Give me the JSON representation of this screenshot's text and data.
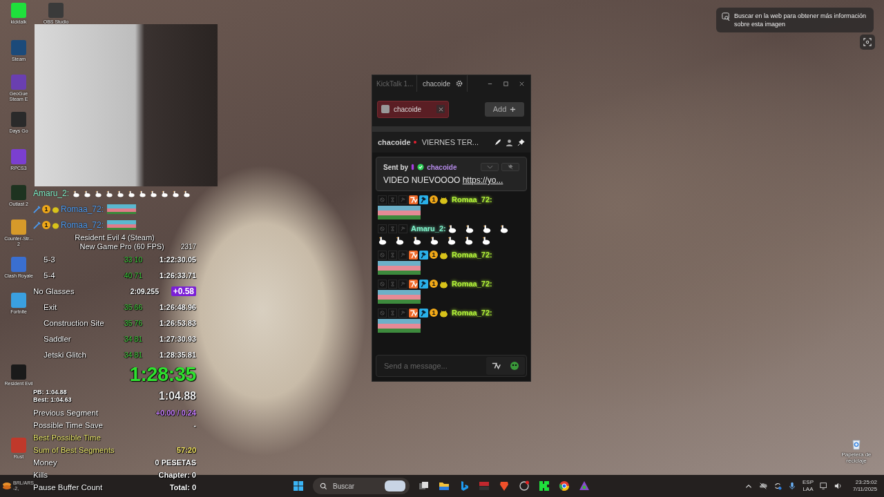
{
  "desktop_icons": [
    {
      "label": "kicktalk",
      "color": "#1fe03c"
    },
    {
      "label": "OBS Studio",
      "color": "#3a3a3a"
    },
    {
      "label": "Steam",
      "color": "#1b4a7a"
    },
    {
      "label": "GeoGue Steam E",
      "color": "#6a3fb0"
    },
    {
      "label": "Days Go",
      "color": "#2a2a2a"
    },
    {
      "label": "RPCS3",
      "color": "#7b3fd0"
    },
    {
      "label": "Outlast 2",
      "color": "#1e3320"
    },
    {
      "label": "Counter-Str... 2",
      "color": "#d79a2a"
    },
    {
      "label": "Clash Royale",
      "color": "#3a6fd0"
    },
    {
      "label": "Fortnite",
      "color": "#3aa0e0"
    },
    {
      "label": "Resident Evil",
      "color": "#1a1a1a"
    },
    {
      "label": "Rust",
      "color": "#c0392b"
    }
  ],
  "recycle_bin": {
    "label": "Papelera de reciclaje"
  },
  "lens_tooltip": {
    "text": "Buscar en la web para obtener más información sobre esta imagen"
  },
  "overlay_chat": [
    {
      "user": "Amaru_2:",
      "color": "#7ef0c8",
      "badged": false,
      "kind": "geese"
    },
    {
      "user": "Romaa_72:",
      "color": "#4a9af0",
      "badged": true,
      "kind": "image",
      "badge_text": "1"
    },
    {
      "user": "Romaa_72:",
      "color": "#4a9af0",
      "badged": true,
      "kind": "image",
      "badge_text": "1"
    }
  ],
  "timer": {
    "game": "Resident Evil 4 (Steam)",
    "category": "New Game Pro (60 FPS)",
    "attempts": "2317",
    "splits": [
      {
        "kind": "split",
        "name": "5-3",
        "delta": "33 10",
        "time": "1:22:30.05",
        "color": "#3bd13b"
      },
      {
        "kind": "split",
        "name": "5-4",
        "delta": "40 71",
        "time": "1:26:33.71",
        "color": "#3bd13b"
      },
      {
        "kind": "header",
        "name": "No Glasses",
        "delta": "2:09.255",
        "time": "+0.58",
        "color": "#7a1fd6"
      },
      {
        "kind": "split",
        "name": "Exit",
        "delta": "35 66",
        "time": "1:26:48.96",
        "color": "#3bd13b"
      },
      {
        "kind": "split",
        "name": "Construction Site",
        "delta": "35 76",
        "time": "1:26:53.83",
        "color": "#3bd13b"
      },
      {
        "kind": "split",
        "name": "Saddler",
        "delta": "34 81",
        "time": "1:27:30.93",
        "color": "#3bd13b"
      },
      {
        "kind": "split",
        "name": "Jetski Glitch",
        "delta": "34 81",
        "time": "1:28:35.81",
        "color": "#3bd13b"
      }
    ],
    "main_time": "1:28:35",
    "pb_label": "PB:",
    "pb": "1:04.88",
    "best_label": "Best:",
    "best": "1:04.63",
    "segment_time": "1:04.88",
    "stats": [
      {
        "label": "Previous Segment",
        "value": "+0.00 / 0.24",
        "highlight": false,
        "color": "#c77dff"
      },
      {
        "label": "Possible Time Save",
        "value": "-",
        "highlight": false
      },
      {
        "label": "Best Possible Time",
        "highlight": true
      },
      {
        "label": "Sum of Best Segments",
        "value": "57:20",
        "highlight": true,
        "color": "#f5e663"
      },
      {
        "label": "Money",
        "value": "0 PESETAS",
        "highlight": false
      },
      {
        "label": "Kills",
        "value": "Chapter: 0",
        "highlight": false
      },
      {
        "label": "Pause Buffer Count",
        "value": "Total: 0",
        "highlight": false
      }
    ]
  },
  "chat_window": {
    "title": "KickTalk 1...",
    "tab": "chacoide",
    "channel_chip": {
      "label": "chacoide",
      "selected": true
    },
    "add_button": "Add",
    "channel_name": "chacoide",
    "live": true,
    "stream_title": "VIERNES TER...",
    "pinned": {
      "sent_by": "Sent by",
      "user": "chacoide",
      "text": "VIDEO NUEVOOOO",
      "link": "https://yo..."
    },
    "messages": [
      {
        "user": "Romaa_72:",
        "color": "#b4f53a",
        "badged": true,
        "kind": "image",
        "badge_text": "1"
      },
      {
        "user": "Amaru_2:",
        "color": "#7ef0c8",
        "badged": false,
        "kind": "geese"
      },
      {
        "user": "Romaa_72:",
        "color": "#b4f53a",
        "badged": true,
        "kind": "image",
        "badge_text": "1"
      },
      {
        "user": "Romaa_72:",
        "color": "#b4f53a",
        "badged": true,
        "kind": "image",
        "badge_text": "1"
      },
      {
        "user": "Romaa_72:",
        "color": "#b4f53a",
        "badged": true,
        "kind": "image",
        "badge_text": "1"
      }
    ],
    "input": {
      "placeholder": "Send a message..."
    }
  },
  "taskbar": {
    "widget_title": "BRL/ARS",
    "widget_value": "-2,",
    "search": {
      "placeholder": "Buscar"
    },
    "language": "ESP",
    "layout": "LAA",
    "time": "23:25:02",
    "date": "7/11/2025"
  }
}
